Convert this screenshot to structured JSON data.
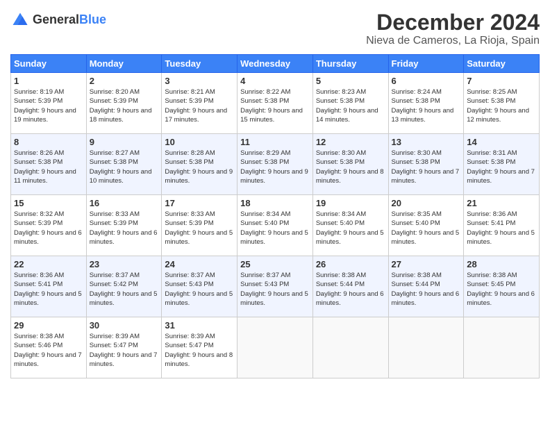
{
  "header": {
    "logo_general": "General",
    "logo_blue": "Blue",
    "month_title": "December 2024",
    "location": "Nieva de Cameros, La Rioja, Spain"
  },
  "days_of_week": [
    "Sunday",
    "Monday",
    "Tuesday",
    "Wednesday",
    "Thursday",
    "Friday",
    "Saturday"
  ],
  "weeks": [
    [
      {
        "day": "1",
        "sunrise": "8:19 AM",
        "sunset": "5:39 PM",
        "daylight": "9 hours and 19 minutes."
      },
      {
        "day": "2",
        "sunrise": "8:20 AM",
        "sunset": "5:39 PM",
        "daylight": "9 hours and 18 minutes."
      },
      {
        "day": "3",
        "sunrise": "8:21 AM",
        "sunset": "5:39 PM",
        "daylight": "9 hours and 17 minutes."
      },
      {
        "day": "4",
        "sunrise": "8:22 AM",
        "sunset": "5:38 PM",
        "daylight": "9 hours and 15 minutes."
      },
      {
        "day": "5",
        "sunrise": "8:23 AM",
        "sunset": "5:38 PM",
        "daylight": "9 hours and 14 minutes."
      },
      {
        "day": "6",
        "sunrise": "8:24 AM",
        "sunset": "5:38 PM",
        "daylight": "9 hours and 13 minutes."
      },
      {
        "day": "7",
        "sunrise": "8:25 AM",
        "sunset": "5:38 PM",
        "daylight": "9 hours and 12 minutes."
      }
    ],
    [
      {
        "day": "8",
        "sunrise": "8:26 AM",
        "sunset": "5:38 PM",
        "daylight": "9 hours and 11 minutes."
      },
      {
        "day": "9",
        "sunrise": "8:27 AM",
        "sunset": "5:38 PM",
        "daylight": "9 hours and 10 minutes."
      },
      {
        "day": "10",
        "sunrise": "8:28 AM",
        "sunset": "5:38 PM",
        "daylight": "9 hours and 9 minutes."
      },
      {
        "day": "11",
        "sunrise": "8:29 AM",
        "sunset": "5:38 PM",
        "daylight": "9 hours and 9 minutes."
      },
      {
        "day": "12",
        "sunrise": "8:30 AM",
        "sunset": "5:38 PM",
        "daylight": "9 hours and 8 minutes."
      },
      {
        "day": "13",
        "sunrise": "8:30 AM",
        "sunset": "5:38 PM",
        "daylight": "9 hours and 7 minutes."
      },
      {
        "day": "14",
        "sunrise": "8:31 AM",
        "sunset": "5:38 PM",
        "daylight": "9 hours and 7 minutes."
      }
    ],
    [
      {
        "day": "15",
        "sunrise": "8:32 AM",
        "sunset": "5:39 PM",
        "daylight": "9 hours and 6 minutes."
      },
      {
        "day": "16",
        "sunrise": "8:33 AM",
        "sunset": "5:39 PM",
        "daylight": "9 hours and 6 minutes."
      },
      {
        "day": "17",
        "sunrise": "8:33 AM",
        "sunset": "5:39 PM",
        "daylight": "9 hours and 5 minutes."
      },
      {
        "day": "18",
        "sunrise": "8:34 AM",
        "sunset": "5:40 PM",
        "daylight": "9 hours and 5 minutes."
      },
      {
        "day": "19",
        "sunrise": "8:34 AM",
        "sunset": "5:40 PM",
        "daylight": "9 hours and 5 minutes."
      },
      {
        "day": "20",
        "sunrise": "8:35 AM",
        "sunset": "5:40 PM",
        "daylight": "9 hours and 5 minutes."
      },
      {
        "day": "21",
        "sunrise": "8:36 AM",
        "sunset": "5:41 PM",
        "daylight": "9 hours and 5 minutes."
      }
    ],
    [
      {
        "day": "22",
        "sunrise": "8:36 AM",
        "sunset": "5:41 PM",
        "daylight": "9 hours and 5 minutes."
      },
      {
        "day": "23",
        "sunrise": "8:37 AM",
        "sunset": "5:42 PM",
        "daylight": "9 hours and 5 minutes."
      },
      {
        "day": "24",
        "sunrise": "8:37 AM",
        "sunset": "5:43 PM",
        "daylight": "9 hours and 5 minutes."
      },
      {
        "day": "25",
        "sunrise": "8:37 AM",
        "sunset": "5:43 PM",
        "daylight": "9 hours and 5 minutes."
      },
      {
        "day": "26",
        "sunrise": "8:38 AM",
        "sunset": "5:44 PM",
        "daylight": "9 hours and 6 minutes."
      },
      {
        "day": "27",
        "sunrise": "8:38 AM",
        "sunset": "5:44 PM",
        "daylight": "9 hours and 6 minutes."
      },
      {
        "day": "28",
        "sunrise": "8:38 AM",
        "sunset": "5:45 PM",
        "daylight": "9 hours and 6 minutes."
      }
    ],
    [
      {
        "day": "29",
        "sunrise": "8:38 AM",
        "sunset": "5:46 PM",
        "daylight": "9 hours and 7 minutes."
      },
      {
        "day": "30",
        "sunrise": "8:39 AM",
        "sunset": "5:47 PM",
        "daylight": "9 hours and 7 minutes."
      },
      {
        "day": "31",
        "sunrise": "8:39 AM",
        "sunset": "5:47 PM",
        "daylight": "9 hours and 8 minutes."
      },
      null,
      null,
      null,
      null
    ]
  ],
  "labels": {
    "sunrise": "Sunrise:",
    "sunset": "Sunset:",
    "daylight": "Daylight:"
  }
}
